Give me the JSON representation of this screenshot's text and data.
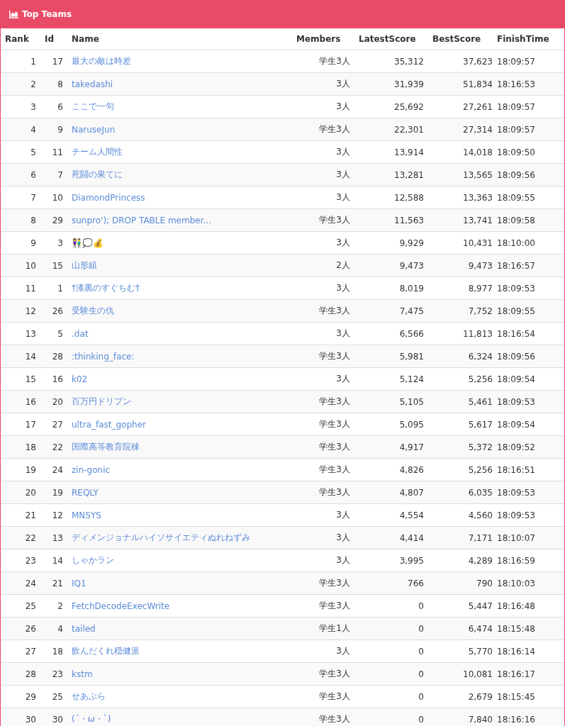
{
  "panel": {
    "title": "Top Teams"
  },
  "table": {
    "columns": [
      "Rank",
      "Id",
      "Name",
      "Members",
      "LatestScore",
      "BestScore",
      "FinishTime"
    ],
    "rows": [
      {
        "rank": "1",
        "id": "17",
        "name": "最大の敵は時差",
        "members": "学生3人",
        "latest_score": "35,312",
        "best_score": "37,623",
        "finish_time": "18:09:57"
      },
      {
        "rank": "2",
        "id": "8",
        "name": "takedashi",
        "members": "3人",
        "latest_score": "31,939",
        "best_score": "51,834",
        "finish_time": "18:16:53"
      },
      {
        "rank": "3",
        "id": "6",
        "name": "ここで一句",
        "members": "3人",
        "latest_score": "25,692",
        "best_score": "27,261",
        "finish_time": "18:09:57"
      },
      {
        "rank": "4",
        "id": "9",
        "name": "NaruseJun",
        "members": "学生3人",
        "latest_score": "22,301",
        "best_score": "27,314",
        "finish_time": "18:09:57"
      },
      {
        "rank": "5",
        "id": "11",
        "name": "チーム人間性",
        "members": "3人",
        "latest_score": "13,914",
        "best_score": "14,018",
        "finish_time": "18:09:50"
      },
      {
        "rank": "6",
        "id": "7",
        "name": "死闘の果てに",
        "members": "3人",
        "latest_score": "13,281",
        "best_score": "13,565",
        "finish_time": "18:09:56"
      },
      {
        "rank": "7",
        "id": "10",
        "name": "DiamondPrincess",
        "members": "3人",
        "latest_score": "12,588",
        "best_score": "13,363",
        "finish_time": "18:09:55"
      },
      {
        "rank": "8",
        "id": "29",
        "name": "sunpro'); DROP TABLE member...",
        "members": "学生3人",
        "latest_score": "11,563",
        "best_score": "13,741",
        "finish_time": "18:09:58"
      },
      {
        "rank": "9",
        "id": "3",
        "name": "👫💭💰",
        "members": "3人",
        "latest_score": "9,929",
        "best_score": "10,431",
        "finish_time": "18:10:00"
      },
      {
        "rank": "10",
        "id": "15",
        "name": "山形組",
        "members": "2人",
        "latest_score": "9,473",
        "best_score": "9,473",
        "finish_time": "18:16:57"
      },
      {
        "rank": "11",
        "id": "1",
        "name": "†漆黒のすぐちむ†",
        "members": "3人",
        "latest_score": "8,019",
        "best_score": "8,977",
        "finish_time": "18:09:53"
      },
      {
        "rank": "12",
        "id": "26",
        "name": "受験生の仇",
        "members": "学生3人",
        "latest_score": "7,475",
        "best_score": "7,752",
        "finish_time": "18:09:55"
      },
      {
        "rank": "13",
        "id": "5",
        "name": ".dat",
        "members": "3人",
        "latest_score": "6,566",
        "best_score": "11,813",
        "finish_time": "18:16:54"
      },
      {
        "rank": "14",
        "id": "28",
        "name": ":thinking_face:",
        "members": "学生3人",
        "latest_score": "5,981",
        "best_score": "6,324",
        "finish_time": "18:09:56"
      },
      {
        "rank": "15",
        "id": "16",
        "name": "k02",
        "members": "3人",
        "latest_score": "5,124",
        "best_score": "5,256",
        "finish_time": "18:09:54"
      },
      {
        "rank": "16",
        "id": "20",
        "name": "百万円ドリブン",
        "members": "学生3人",
        "latest_score": "5,105",
        "best_score": "5,461",
        "finish_time": "18:09:53"
      },
      {
        "rank": "17",
        "id": "27",
        "name": "ultra_fast_gopher",
        "members": "学生3人",
        "latest_score": "5,095",
        "best_score": "5,617",
        "finish_time": "18:09:54"
      },
      {
        "rank": "18",
        "id": "22",
        "name": "国際高等教育院棟",
        "members": "学生3人",
        "latest_score": "4,917",
        "best_score": "5,372",
        "finish_time": "18:09:52"
      },
      {
        "rank": "19",
        "id": "24",
        "name": "zin-gonic",
        "members": "学生3人",
        "latest_score": "4,826",
        "best_score": "5,256",
        "finish_time": "18:16:51"
      },
      {
        "rank": "20",
        "id": "19",
        "name": "REQLY",
        "members": "学生3人",
        "latest_score": "4,807",
        "best_score": "6,035",
        "finish_time": "18:09:53"
      },
      {
        "rank": "21",
        "id": "12",
        "name": "MNSYS",
        "members": "3人",
        "latest_score": "4,554",
        "best_score": "4,560",
        "finish_time": "18:09:53"
      },
      {
        "rank": "22",
        "id": "13",
        "name": "ディメンジョナルハイソサイエティぬれねずみ",
        "members": "3人",
        "latest_score": "4,414",
        "best_score": "7,171",
        "finish_time": "18:10:07"
      },
      {
        "rank": "23",
        "id": "14",
        "name": "しゃかラン",
        "members": "3人",
        "latest_score": "3,995",
        "best_score": "4,289",
        "finish_time": "18:16:59"
      },
      {
        "rank": "24",
        "id": "21",
        "name": "IQ1",
        "members": "学生3人",
        "latest_score": "766",
        "best_score": "790",
        "finish_time": "18:10:03"
      },
      {
        "rank": "25",
        "id": "2",
        "name": "FetchDecodeExecWrite",
        "members": "学生3人",
        "latest_score": "0",
        "best_score": "5,447",
        "finish_time": "18:16:48"
      },
      {
        "rank": "26",
        "id": "4",
        "name": "tailed",
        "members": "学生1人",
        "latest_score": "0",
        "best_score": "6,474",
        "finish_time": "18:15:48"
      },
      {
        "rank": "27",
        "id": "18",
        "name": "飲んだくれ穏健派",
        "members": "3人",
        "latest_score": "0",
        "best_score": "5,770",
        "finish_time": "18:16:14"
      },
      {
        "rank": "28",
        "id": "23",
        "name": "kstm",
        "members": "学生3人",
        "latest_score": "0",
        "best_score": "10,081",
        "finish_time": "18:16:17"
      },
      {
        "rank": "29",
        "id": "25",
        "name": "せあぶら",
        "members": "学生3人",
        "latest_score": "0",
        "best_score": "2,679",
        "finish_time": "18:15:45"
      },
      {
        "rank": "30",
        "id": "30",
        "name": "(´・ω・`)",
        "members": "学生3人",
        "latest_score": "0",
        "best_score": "7,840",
        "finish_time": "18:16:16"
      }
    ]
  }
}
